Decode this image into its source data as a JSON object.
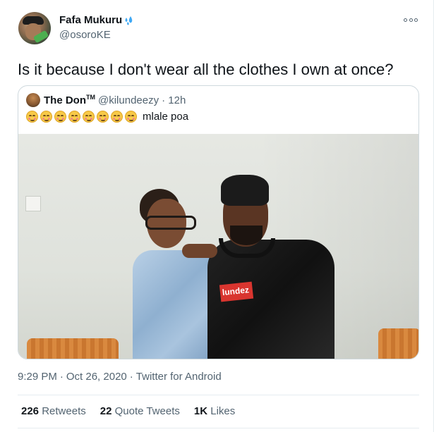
{
  "tweet": {
    "author": {
      "display_name": "Fafa Mukuru",
      "name_icon": "sweat-droplets-icon",
      "handle": "@osoroKE"
    },
    "more_icon": "more-icon",
    "text": "Is it because I don't wear all the clothes I own at once?",
    "quote": {
      "display_name": "The Don",
      "tm": "TM",
      "handle": "@kilundeezy",
      "time": "· 12h",
      "emoji_icon": "smiling-face-with-smiling-eyes-icon",
      "emoji_count": 8,
      "text": "mlale poa",
      "image_shirt_text": "lundez"
    },
    "meta": {
      "time": "9:29 PM",
      "date": "Oct 26, 2020",
      "source": "Twitter for Android"
    },
    "stats": {
      "retweets_count": "226",
      "retweets_label": "Retweets",
      "quote_tweets_count": "22",
      "quote_tweets_label": "Quote Tweets",
      "likes_count": "1K",
      "likes_label": "Likes"
    }
  }
}
